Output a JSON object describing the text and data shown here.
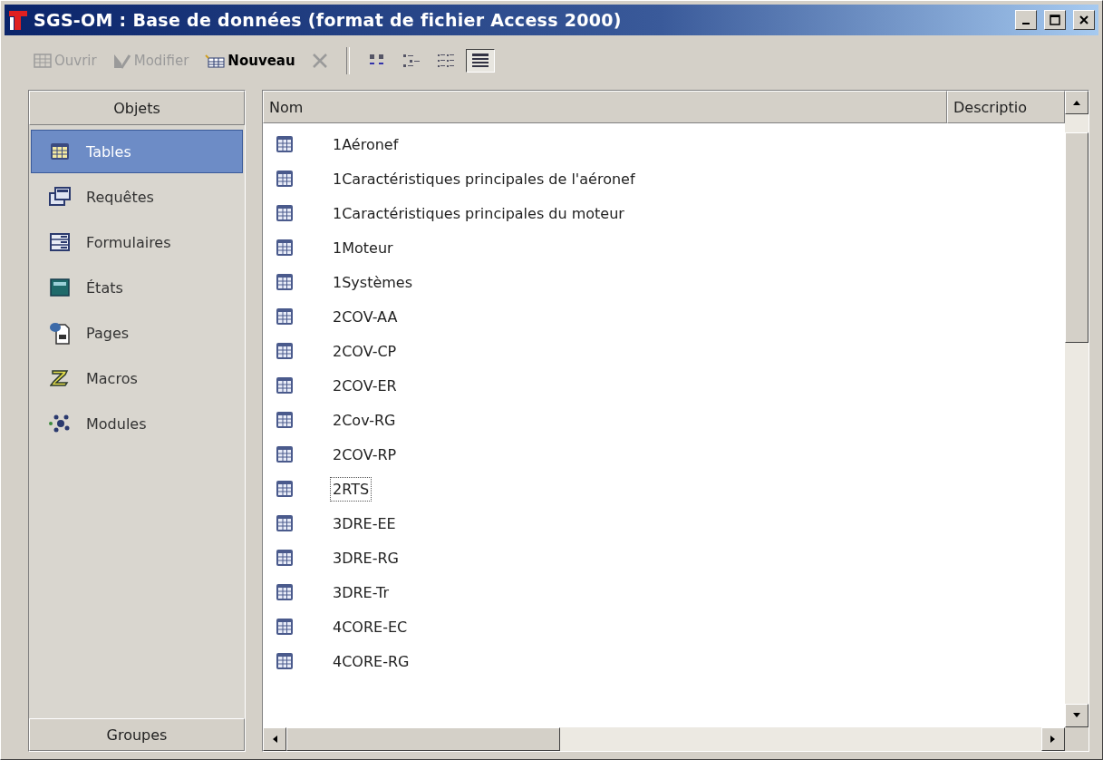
{
  "window": {
    "title": "SGS-OM : Base de données (format de fichier Access 2000)"
  },
  "actions": [
    {
      "kind": "open",
      "label": "Ouvrir",
      "disabled": true
    },
    {
      "kind": "design",
      "label": "Modifier",
      "disabled": true
    },
    {
      "kind": "new",
      "label": "Nouveau",
      "disabled": false
    },
    {
      "kind": "delete",
      "disabled": true
    }
  ],
  "views": [
    {
      "kind": "large-icons",
      "selected": false
    },
    {
      "kind": "small-icons",
      "selected": false
    },
    {
      "kind": "list",
      "selected": false
    },
    {
      "kind": "details",
      "selected": true
    }
  ],
  "sidebar": {
    "heading": "Objets",
    "items": [
      {
        "kind": "tables",
        "label": "Tables",
        "selected": true
      },
      {
        "kind": "queries",
        "label": "Requêtes",
        "selected": false
      },
      {
        "kind": "forms",
        "label": "Formulaires",
        "selected": false
      },
      {
        "kind": "reports",
        "label": "États",
        "selected": false
      },
      {
        "kind": "pages",
        "label": "Pages",
        "selected": false
      },
      {
        "kind": "macros",
        "label": "Macros",
        "selected": false
      },
      {
        "kind": "modules",
        "label": "Modules",
        "selected": false
      }
    ],
    "footer": "Groupes"
  },
  "list": {
    "columns": [
      "Nom",
      "Descriptio"
    ],
    "rows": [
      {
        "name": "1Aéronef",
        "focused": false
      },
      {
        "name": "1Caractéristiques principales de l'aéronef",
        "focused": false
      },
      {
        "name": "1Caractéristiques principales du moteur",
        "focused": false
      },
      {
        "name": "1Moteur",
        "focused": false
      },
      {
        "name": "1Systèmes",
        "focused": false
      },
      {
        "name": "2COV-AA",
        "focused": false
      },
      {
        "name": "2COV-CP",
        "focused": false
      },
      {
        "name": "2COV-ER",
        "focused": false
      },
      {
        "name": "2Cov-RG",
        "focused": false
      },
      {
        "name": "2COV-RP",
        "focused": false
      },
      {
        "name": "2RTS",
        "focused": true
      },
      {
        "name": "3DRE-EE",
        "focused": false
      },
      {
        "name": "3DRE-RG",
        "focused": false
      },
      {
        "name": "3DRE-Tr",
        "focused": false
      },
      {
        "name": "4CORE-EC",
        "focused": false
      },
      {
        "name": "4CORE-RG",
        "focused": false
      }
    ]
  }
}
